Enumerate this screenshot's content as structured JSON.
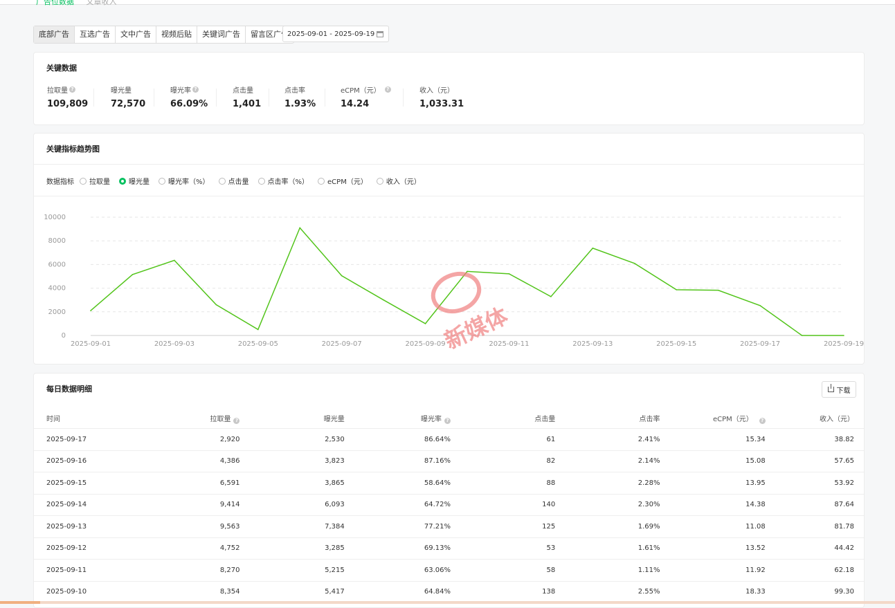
{
  "breadcrumb": [
    "广告位数据",
    "文章收入"
  ],
  "tabs": [
    "底部广告",
    "互选广告",
    "文中广告",
    "视频后贴",
    "关键词广告",
    "留言区广告"
  ],
  "date_range": "2025-09-01 - 2025-09-19",
  "key_data": {
    "title": "关键数据",
    "metrics": [
      {
        "label": "拉取量",
        "value": "109,809",
        "help": true
      },
      {
        "label": "曝光量",
        "value": "72,570",
        "help": false
      },
      {
        "label": "曝光率",
        "value": "66.09%",
        "help": true
      },
      {
        "label": "点击量",
        "value": "1,401",
        "help": false
      },
      {
        "label": "点击率",
        "value": "1.93%",
        "help": false
      },
      {
        "label": "eCPM（元）",
        "value": "14.24",
        "help": true
      },
      {
        "label": "收入（元）",
        "value": "1,033.31",
        "help": false
      }
    ]
  },
  "trend": {
    "title": "关键指标趋势图",
    "selector_label": "数据指标",
    "options": [
      "拉取量",
      "曝光量",
      "曝光率（%）",
      "点击量",
      "点击率（%）",
      "eCPM（元）",
      "收入（元）"
    ],
    "selected_index": 1
  },
  "watermark": "新媒体",
  "chart_data": {
    "type": "line",
    "x": [
      "2025-09-01",
      "2025-09-02",
      "2025-09-03",
      "2025-09-04",
      "2025-09-05",
      "2025-09-06",
      "2025-09-07",
      "2025-09-08",
      "2025-09-09",
      "2025-09-10",
      "2025-09-11",
      "2025-09-12",
      "2025-09-13",
      "2025-09-14",
      "2025-09-15",
      "2025-09-16",
      "2025-09-17",
      "2025-09-18",
      "2025-09-19"
    ],
    "xticks": [
      "2025-09-01",
      "2025-09-03",
      "2025-09-05",
      "2025-09-07",
      "2025-09-09",
      "2025-09-11",
      "2025-09-13",
      "2025-09-15",
      "2025-09-17",
      "2025-09-19"
    ],
    "series": [
      {
        "values": [
          2100,
          5150,
          6350,
          2600,
          500,
          9100,
          5050,
          3000,
          1000,
          5417,
          5215,
          3285,
          7384,
          6093,
          3865,
          3823,
          2530,
          0,
          0
        ]
      }
    ],
    "yticks": [
      0,
      2000,
      4000,
      6000,
      8000,
      10000
    ],
    "ylim": [
      0,
      10000
    ],
    "grid": true,
    "color": "#52c41a"
  },
  "daily": {
    "title": "每日数据明细",
    "download_label": "下载",
    "columns": [
      {
        "label": "时间",
        "help": false
      },
      {
        "label": "拉取量",
        "help": true
      },
      {
        "label": "曝光量",
        "help": false
      },
      {
        "label": "曝光率",
        "help": true
      },
      {
        "label": "点击量",
        "help": false
      },
      {
        "label": "点击率",
        "help": false
      },
      {
        "label": "eCPM（元）",
        "help": true
      },
      {
        "label": "收入（元）",
        "help": false
      }
    ],
    "rows": [
      [
        "2025-09-17",
        "2,920",
        "2,530",
        "86.64%",
        "61",
        "2.41%",
        "15.34",
        "38.82"
      ],
      [
        "2025-09-16",
        "4,386",
        "3,823",
        "87.16%",
        "82",
        "2.14%",
        "15.08",
        "57.65"
      ],
      [
        "2025-09-15",
        "6,591",
        "3,865",
        "58.64%",
        "88",
        "2.28%",
        "13.95",
        "53.92"
      ],
      [
        "2025-09-14",
        "9,414",
        "6,093",
        "64.72%",
        "140",
        "2.30%",
        "14.38",
        "87.64"
      ],
      [
        "2025-09-13",
        "9,563",
        "7,384",
        "77.21%",
        "125",
        "1.69%",
        "11.08",
        "81.78"
      ],
      [
        "2025-09-12",
        "4,752",
        "3,285",
        "69.13%",
        "53",
        "1.61%",
        "13.52",
        "44.42"
      ],
      [
        "2025-09-11",
        "8,270",
        "5,215",
        "63.06%",
        "58",
        "1.11%",
        "11.92",
        "62.18"
      ],
      [
        "2025-09-10",
        "8,354",
        "5,417",
        "64.84%",
        "138",
        "2.55%",
        "18.33",
        "99.30"
      ]
    ]
  }
}
